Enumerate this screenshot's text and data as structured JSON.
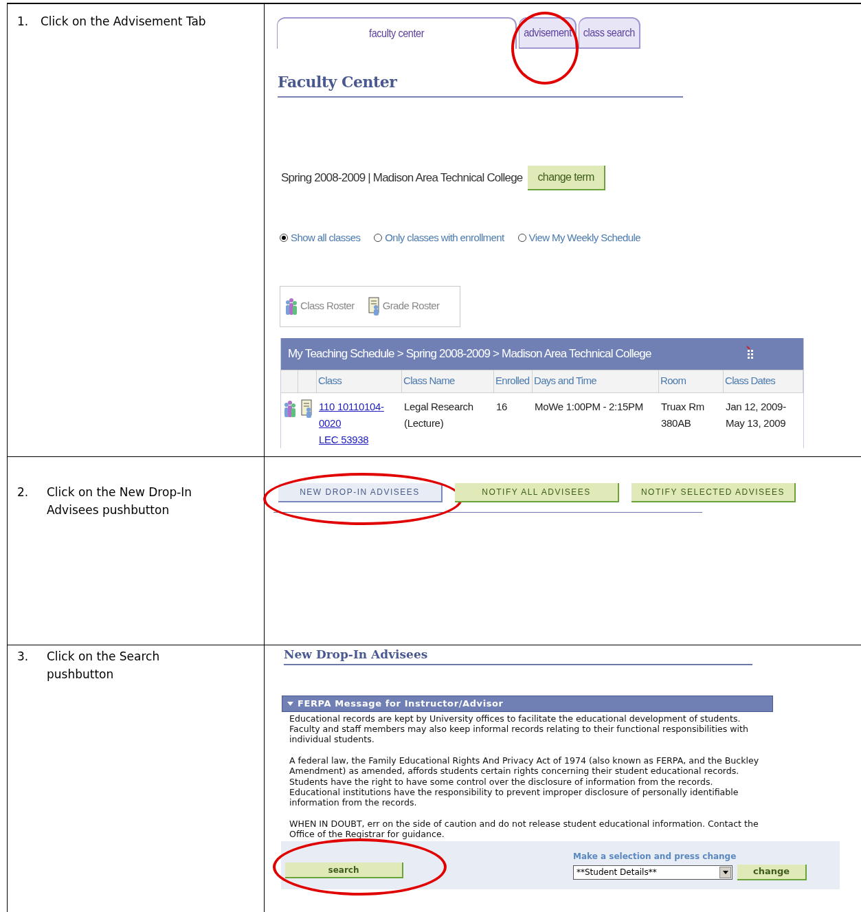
{
  "steps": [
    {
      "number": "1.",
      "text": "Click on the Advisement Tab"
    },
    {
      "number": "2.",
      "text": "Click on the New Drop-In Advisees pushbutton"
    },
    {
      "number": "3.",
      "text": "Click on the Search pushbutton"
    }
  ],
  "faculty_center": {
    "tabs": [
      {
        "label": "faculty center",
        "selected": true,
        "circled": false
      },
      {
        "label": "advisement",
        "selected": false,
        "circled": true
      },
      {
        "label": "class search",
        "selected": false,
        "circled": false
      }
    ],
    "title": "Faculty Center",
    "term": "Spring 2008-2009 | Madison Area Technical College",
    "change_term_button": "change term",
    "view_options": [
      {
        "label": "Show all classes",
        "selected": true
      },
      {
        "label": "Only classes with enrollment",
        "selected": false
      },
      {
        "label": "View My Weekly Schedule",
        "selected": false
      }
    ],
    "roster_links": [
      {
        "kind": "class",
        "label": "Class Roster"
      },
      {
        "kind": "grade",
        "label": "Grade Roster"
      }
    ],
    "schedule": {
      "title": "My Teaching Schedule > Spring 2008-2009 > Madison Area Technical College",
      "columns": [
        "Class",
        "Class Name",
        "Enrolled",
        "Days and Time",
        "Room",
        "Class Dates"
      ],
      "rows": [
        {
          "class": "110 10110104-0020",
          "section": "LEC 53938",
          "class_name": "Legal Research (Lecture)",
          "enrolled": "16",
          "days_and_time": "MoWe 1:00PM - 2:15PM",
          "room": "Truax Rm 380AB",
          "class_dates": "Jan 12, 2009-May 13, 2009"
        }
      ]
    }
  },
  "advisement": {
    "buttons": [
      {
        "label": "NEW DROP-IN ADVISEES",
        "kind": "current",
        "circled": true
      },
      {
        "label": "NOTIFY ALL ADVISEES",
        "kind": "action",
        "circled": false
      },
      {
        "label": "NOTIFY SELECTED ADVISEES",
        "kind": "action",
        "circled": false
      }
    ]
  },
  "drop_in": {
    "title": "New Drop-In Advisees",
    "section": {
      "title": "FERPA Message for Instructor/Advisor",
      "expanded": true,
      "paragraphs": [
        "Educational records are kept by University offices to facilitate the educational development of students. Faculty and staff members may also keep informal records relating to their functional responsibilities with individual students.",
        "A federal law, the Family Educational Rights And Privacy Act of 1974 (also known as FERPA, and the Buckley Amendment) as amended, affords students certain rights concerning their student educational records. Students have the right to have some control over the disclosure of information from the records. Educational institutions have the responsibility to prevent improper disclosure of personally identifiable information from the records.",
        "WHEN IN DOUBT, err on the side of caution and do not release student educational information. Contact the Office of the Registrar for guidance."
      ]
    },
    "search_button": {
      "label": "search",
      "circled": true
    },
    "select_label": "Make a selection and press change",
    "select_value": "**Student Details**",
    "change_button": "change"
  }
}
